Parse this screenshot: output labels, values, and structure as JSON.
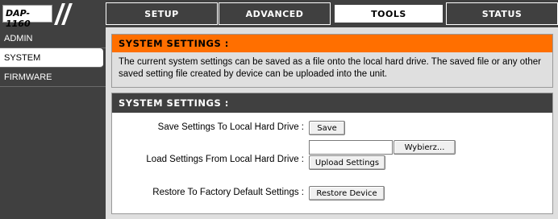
{
  "logo": {
    "text": "DAP-1160"
  },
  "tabs": [
    {
      "label": "SETUP",
      "active": false
    },
    {
      "label": "ADVANCED",
      "active": false
    },
    {
      "label": "TOOLS",
      "active": true
    },
    {
      "label": "STATUS",
      "active": false
    }
  ],
  "sidebar": {
    "items": [
      {
        "label": "ADMIN",
        "active": false
      },
      {
        "label": "SYSTEM",
        "active": true
      },
      {
        "label": "FIRMWARE",
        "active": false
      }
    ]
  },
  "info_box": {
    "title": "SYSTEM SETTINGS :",
    "description": "The current system settings can be saved as a file onto the local hard drive. The saved file or any other saved setting file created by device can be uploaded into the unit."
  },
  "settings_box": {
    "title": "SYSTEM SETTINGS :",
    "save": {
      "label": "Save Settings To Local Hard Drive :",
      "button": "Save"
    },
    "load": {
      "label": "Load Settings From Local Hard Drive :",
      "file_value": "",
      "browse_button": "Wybierz...",
      "upload_button": "Upload Settings"
    },
    "restore": {
      "label": "Restore To Factory Default Settings :",
      "button": "Restore Device"
    }
  },
  "colors": {
    "orange": "#ff6f00",
    "dark": "#404040",
    "panel": "#dfdfdf"
  }
}
